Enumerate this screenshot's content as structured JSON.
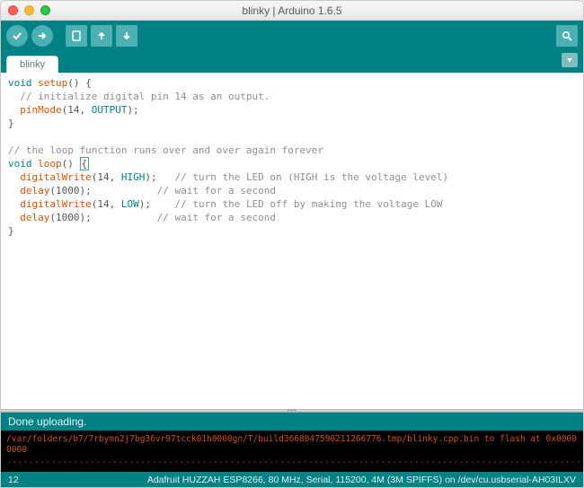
{
  "window": {
    "title": "blinky | Arduino 1.6.5"
  },
  "tabs": {
    "active": "blinky"
  },
  "code": {
    "l1_a": "void",
    "l1_b": " setup",
    "l1_c": "() {",
    "l2": "  // initialize digital pin 14 as an output.",
    "l3_a": "  pinMode",
    "l3_b": "(14, ",
    "l3_c": "OUTPUT",
    "l3_d": ");",
    "l4": "}",
    "l5": "",
    "l6": "// the loop function runs over and over again forever",
    "l7_a": "void",
    "l7_b": " loop",
    "l7_c": "() ",
    "l7_d": "{",
    "l8_a": "  digitalWrite",
    "l8_b": "(14, ",
    "l8_c": "HIGH",
    "l8_d": ");   ",
    "l8_e": "// turn the LED on (HIGH is the voltage level)",
    "l9_a": "  delay",
    "l9_b": "(1000);           ",
    "l9_e": "// wait for a second",
    "l10_a": "  digitalWrite",
    "l10_b": "(14, ",
    "l10_c": "LOW",
    "l10_d": ");    ",
    "l10_e": "// turn the LED off by making the voltage LOW",
    "l11_a": "  delay",
    "l11_b": "(1000);           ",
    "l11_e": "// wait for a second",
    "l12": "}"
  },
  "status": {
    "message": "Done uploading."
  },
  "console": {
    "line1": "/var/folders/b7/7rbymn2j7bg36vr97tcck01h0000gn/T/build3668047590211266776.tmp/blinky.cpp.bin to flash at 0x00000000",
    "dots1": "........................................................................................................................",
    "dots2": "........................................................................................................................"
  },
  "footer": {
    "line": "12",
    "board": "Adafruit HUZZAH ESP8266, 80 MHz, Serial, 115200, 4M (3M SPIFFS) on /dev/cu.usbserial-AH03ILXV"
  }
}
